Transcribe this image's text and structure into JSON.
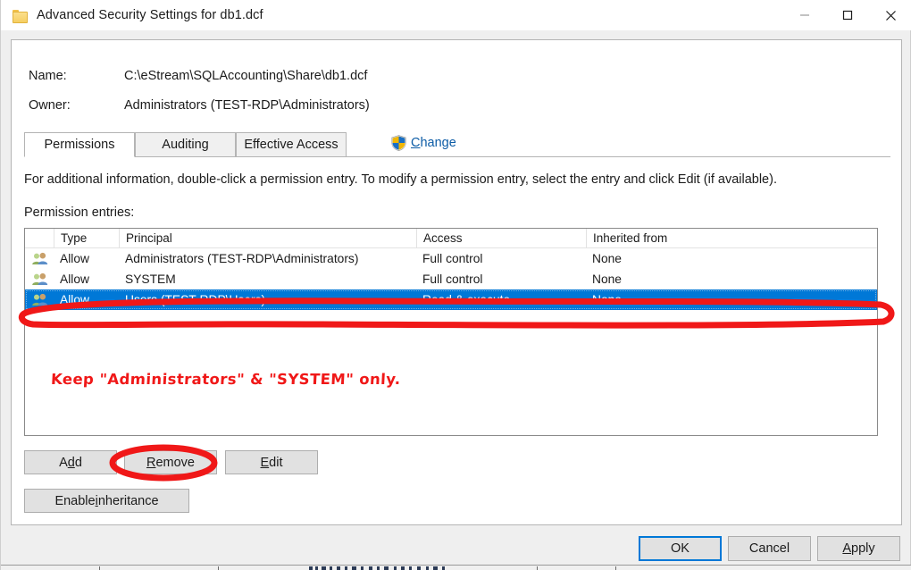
{
  "window": {
    "title": "Advanced Security Settings for db1.dcf",
    "icon": "folder-icon",
    "minimize_label": "Minimize",
    "maximize_label": "Maximize",
    "close_label": "Close"
  },
  "header": {
    "name_label": "Name:",
    "name_value": "C:\\eStream\\SQLAccounting\\Share\\db1.dcf",
    "owner_label": "Owner:",
    "owner_value": "Administrators (TEST-RDP\\Administrators)",
    "change_link_prefix": "C",
    "change_link_rest": "hange",
    "shield_icon": "uac-shield-icon"
  },
  "tabs": [
    {
      "label": "Permissions",
      "active": true
    },
    {
      "label": "Auditing",
      "active": false
    },
    {
      "label": "Effective Access",
      "active": false
    }
  ],
  "main": {
    "info_text": "For additional information, double-click a permission entry. To modify a permission entry, select the entry and click Edit (if available).",
    "entries_label": "Permission entries:"
  },
  "table": {
    "columns": [
      "Type",
      "Principal",
      "Access",
      "Inherited from"
    ],
    "rows": [
      {
        "icon": "group-users-icon",
        "type": "Allow",
        "principal": "Administrators (TEST-RDP\\Administrators)",
        "access": "Full control",
        "inherited_from": "None",
        "selected": false
      },
      {
        "icon": "group-users-icon",
        "type": "Allow",
        "principal": "SYSTEM",
        "access": "Full control",
        "inherited_from": "None",
        "selected": false
      },
      {
        "icon": "group-users-icon",
        "type": "Allow",
        "principal": "Users (TEST-RDP\\Users)",
        "access": "Read & execute",
        "inherited_from": "None",
        "selected": true
      }
    ]
  },
  "annotation": {
    "note_text": "Keep \"Administrators\" & \"SYSTEM\" only.",
    "color": "#f01818",
    "highlight_row_index": 2,
    "highlight_button": "Remove"
  },
  "actions": {
    "add": {
      "pre": "A",
      "accel": "d",
      "post": "d"
    },
    "remove": {
      "pre": "",
      "accel": "R",
      "post": "emove"
    },
    "edit": {
      "pre": "",
      "accel": "E",
      "post": "dit"
    },
    "enable_inheritance": {
      "pre": "Enable ",
      "accel": "i",
      "post": "nheritance"
    }
  },
  "footer": {
    "ok": {
      "label": "OK",
      "focused": true
    },
    "cancel": {
      "label": "Cancel",
      "focused": false
    },
    "apply": {
      "pre": "",
      "accel": "A",
      "post": "pply"
    }
  },
  "colors": {
    "selection_blue": "#0078d7",
    "link_blue": "#0d5ca6",
    "annotation_red": "#f01818",
    "dialog_bg": "#efefef",
    "button_bg": "#e1e1e1"
  }
}
